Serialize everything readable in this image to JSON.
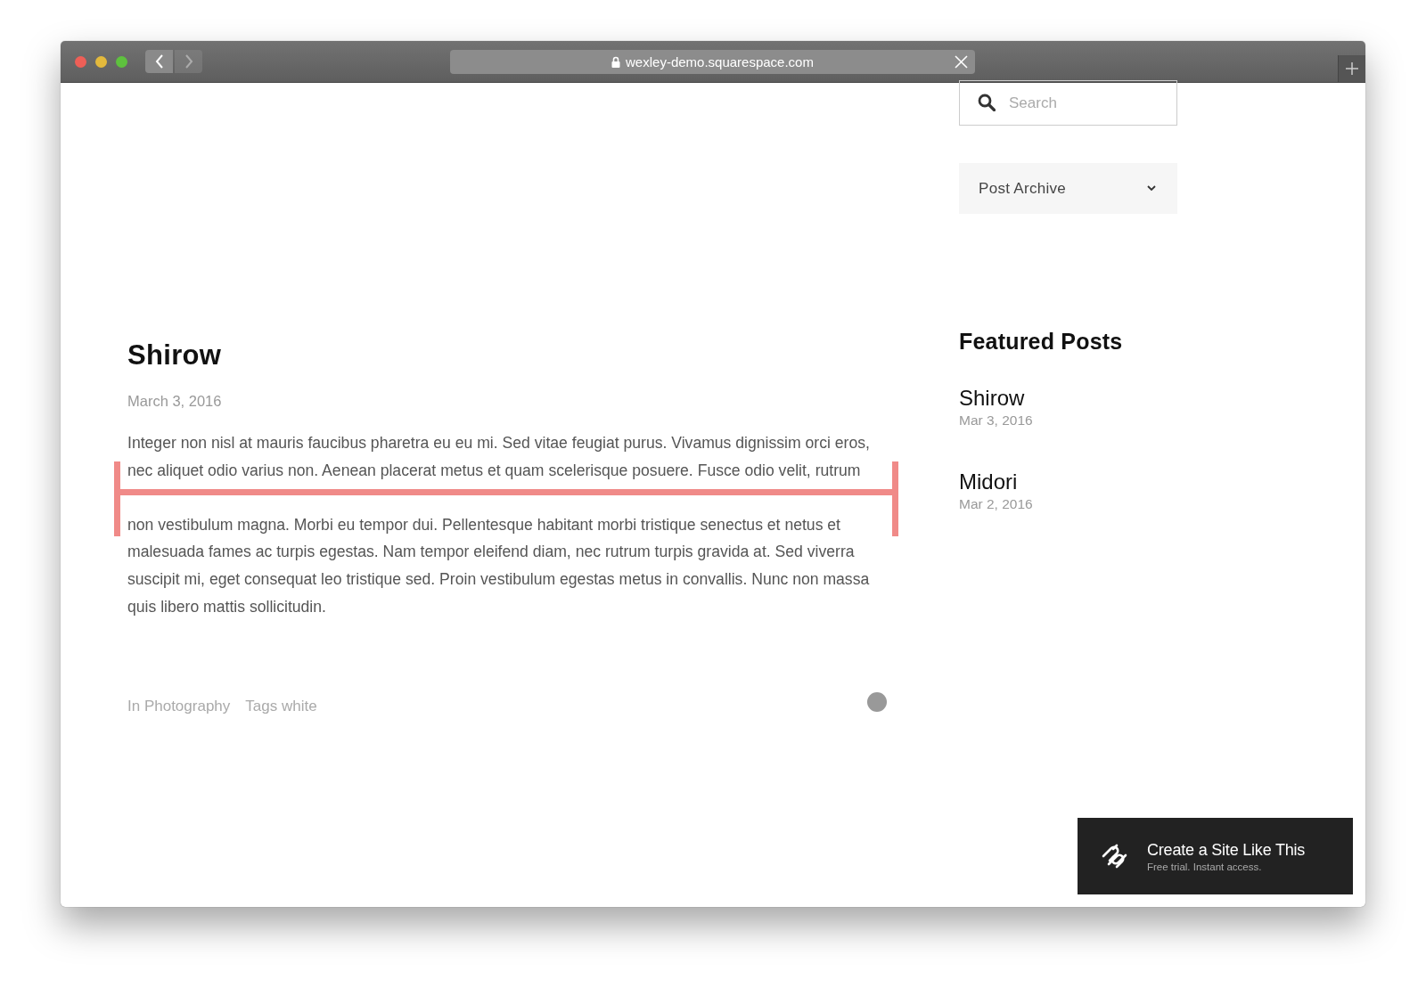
{
  "browser": {
    "url": "wexley-demo.squarespace.com",
    "back_disabled": false,
    "forward_disabled": true
  },
  "post": {
    "title": "Shirow",
    "date": "March 3, 2016",
    "body_before_mark": [
      "Integer non nisl at mauris faucibus pharetra eu eu mi. Sed vitae feugiat purus. Vivamus dignissim orci eros,",
      "nec aliquet odio varius non. Aenean placerat metus et quam scelerisque posuere. Fusce odio velit, rutrum"
    ],
    "body_after_mark": [
      "non vestibulum magna. Morbi eu tempor dui. Pellentesque habitant morbi tristique senectus et netus et",
      "malesuada fames ac turpis egestas. Nam tempor eleifend diam, nec rutrum turpis gravida at. Sed viverra",
      "suscipit mi, eget consequat leo tristique sed. Proin vestibulum egestas metus in convallis. Nunc non massa",
      "quis libero mattis sollicitudin."
    ],
    "category": "In Photography",
    "tags": "Tags white"
  },
  "sidebar": {
    "search": {
      "placeholder": "Search"
    },
    "archive_dropdown": {
      "label": "Post Archive"
    },
    "featured": {
      "heading": "Featured Posts",
      "posts": [
        {
          "title": "Shirow",
          "date": "Mar 3, 2016"
        },
        {
          "title": "Midori",
          "date": "Mar 2, 2016"
        }
      ]
    }
  },
  "banner": {
    "title": "Create a Site Like This",
    "subtitle": "Free trial. Instant access."
  }
}
